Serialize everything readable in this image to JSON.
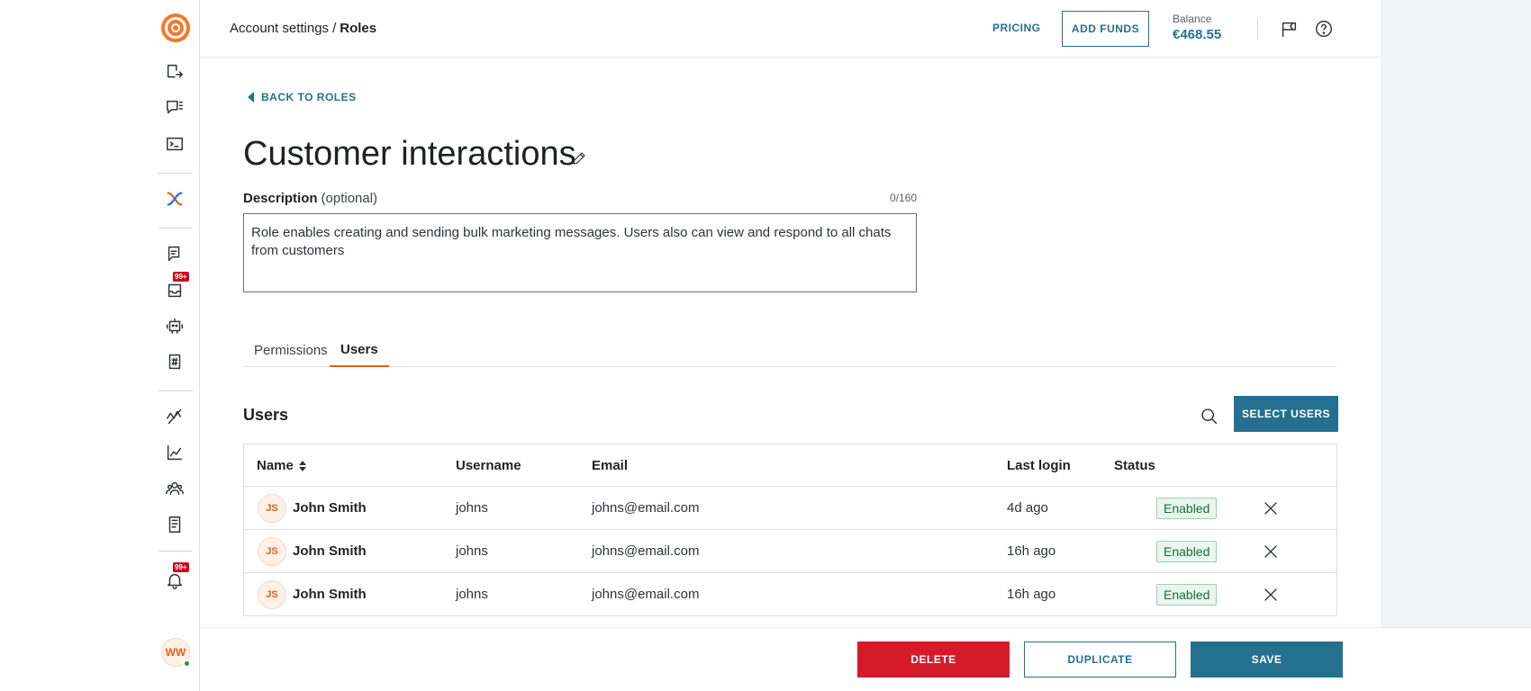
{
  "header": {
    "breadcrumb_parent": "Account settings",
    "breadcrumb_separator": "/",
    "breadcrumb_current": "Roles",
    "pricing_label": "PRICING",
    "add_funds_label": "ADD FUNDS",
    "balance_label": "Balance",
    "balance_value": "€468.55",
    "icons": [
      "flag-icon",
      "help-icon"
    ]
  },
  "sidebar": {
    "icons": [
      "send-icon",
      "chat-list-icon",
      "terminal-icon",
      "exchange-icon",
      "conversations-icon",
      "inbox-icon",
      "bot-icon",
      "tags-icon",
      "analytics-icon",
      "chart-icon",
      "people-icon",
      "book-icon",
      "bell-icon"
    ],
    "inbox_badge": "99+",
    "notifications_badge": "99+",
    "user_initials": "WW"
  },
  "page": {
    "back_label": "BACK TO ROLES",
    "role_title": "Customer interactions",
    "description_label": "Description",
    "description_optional": "(optional)",
    "description_count": "0/160",
    "description_value": "Role enables creating and sending bulk marketing messages. Users also can view and respond to all chats from customers",
    "tabs": [
      {
        "label": "Permissions",
        "active": false
      },
      {
        "label": "Users",
        "active": true
      }
    ],
    "users_heading": "Users",
    "select_users_label": "SELECT USERS"
  },
  "table": {
    "columns": [
      "Name",
      "Username",
      "Email",
      "Last login",
      "Status"
    ],
    "rows": [
      {
        "initials": "JS",
        "name": "John Smith",
        "username": "johns",
        "email": "johns@email.com",
        "last_login": "4d ago",
        "status": "Enabled"
      },
      {
        "initials": "JS",
        "name": "John Smith",
        "username": "johns",
        "email": "johns@email.com",
        "last_login": "16h ago",
        "status": "Enabled"
      },
      {
        "initials": "JS",
        "name": "John Smith",
        "username": "johns",
        "email": "johns@email.com",
        "last_login": "16h ago",
        "status": "Enabled"
      }
    ]
  },
  "footer": {
    "delete_label": "DELETE",
    "duplicate_label": "DUPLICATE",
    "save_label": "SAVE"
  },
  "colors": {
    "accent": "#26708f",
    "brand": "#f4782a",
    "danger": "#d71a2a",
    "success": "#1c6b3e"
  }
}
